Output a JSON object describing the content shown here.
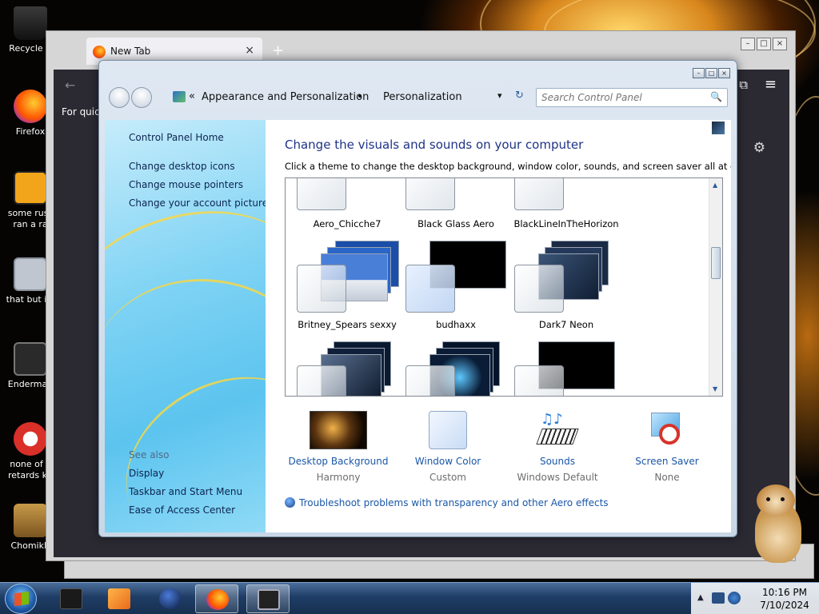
{
  "desktop": {
    "icons": [
      {
        "label": "Recycle B",
        "color": "#2a2a2a"
      },
      {
        "label": "Firefox",
        "color": "#ff7a1a"
      },
      {
        "label": "some russ ran a ra",
        "color": "#f2a51a"
      },
      {
        "label": "that but its",
        "color": "#bfc6cf"
      },
      {
        "label": "Enderman",
        "color": "#3a3a3a"
      },
      {
        "label": "none of y retards kn",
        "color": "#d9302a"
      },
      {
        "label": "ChomikB",
        "color": "#b98a3a"
      }
    ]
  },
  "browser": {
    "tab_title": "New Tab",
    "tab_close": "×",
    "new_tab": "+",
    "quick_text": "For quick",
    "back": "←",
    "menu": "≡",
    "gear": "⚙",
    "extensions": "⧉"
  },
  "window_controls": {
    "minimize": "–",
    "maximize": "□",
    "close": "×"
  },
  "control_panel": {
    "breadcrumb_chevrons": "«",
    "breadcrumb": [
      "Appearance and Personalization",
      "Personalization"
    ],
    "separator": "•",
    "dropdown": "▾",
    "refresh": "↻",
    "search_placeholder": "Search Control Panel",
    "search_icon": "🔍",
    "left_links": [
      "Control Panel Home",
      "Change desktop icons",
      "Change mouse pointers",
      "Change your account picture"
    ],
    "see_also_label": "See also",
    "see_also_links": [
      "Display",
      "Taskbar and Start Menu",
      "Ease of Access Center"
    ],
    "heading": "Change the visuals and sounds on your computer",
    "description": "Click a theme to change the desktop background, window color, sounds, and screen saver all at once.",
    "themes": [
      {
        "name": "Aero_Chicche7",
        "bg": "#1c2a1a"
      },
      {
        "name": "Black Glass Aero",
        "bg": "#0a0a0a"
      },
      {
        "name": "BlackLineInTheHorizon",
        "bg": "#050505"
      },
      {
        "name": "Britney_Spears sexxy",
        "bg": "#2a66c8"
      },
      {
        "name": "budhaxx",
        "bg": "#000000"
      },
      {
        "name": "Dark7 Neon",
        "bg": "#1a2a44"
      },
      {
        "name": "",
        "bg": "#10203a"
      },
      {
        "name": "",
        "bg": "#0a1c36"
      },
      {
        "name": "",
        "bg": "#000000"
      }
    ],
    "scroll_up": "▲",
    "scroll_down": "▼",
    "bottom": [
      {
        "label": "Desktop Background",
        "sub": "Harmony"
      },
      {
        "label": "Window Color",
        "sub": "Custom"
      },
      {
        "label": "Sounds",
        "sub": "Windows Default"
      },
      {
        "label": "Screen Saver",
        "sub": "None"
      }
    ],
    "troubleshoot": "Troubleshoot problems with transparency and other Aero effects"
  },
  "taskbar": {
    "tray_arrow": "▲",
    "time": "10:16 PM",
    "date": "7/10/2024"
  }
}
